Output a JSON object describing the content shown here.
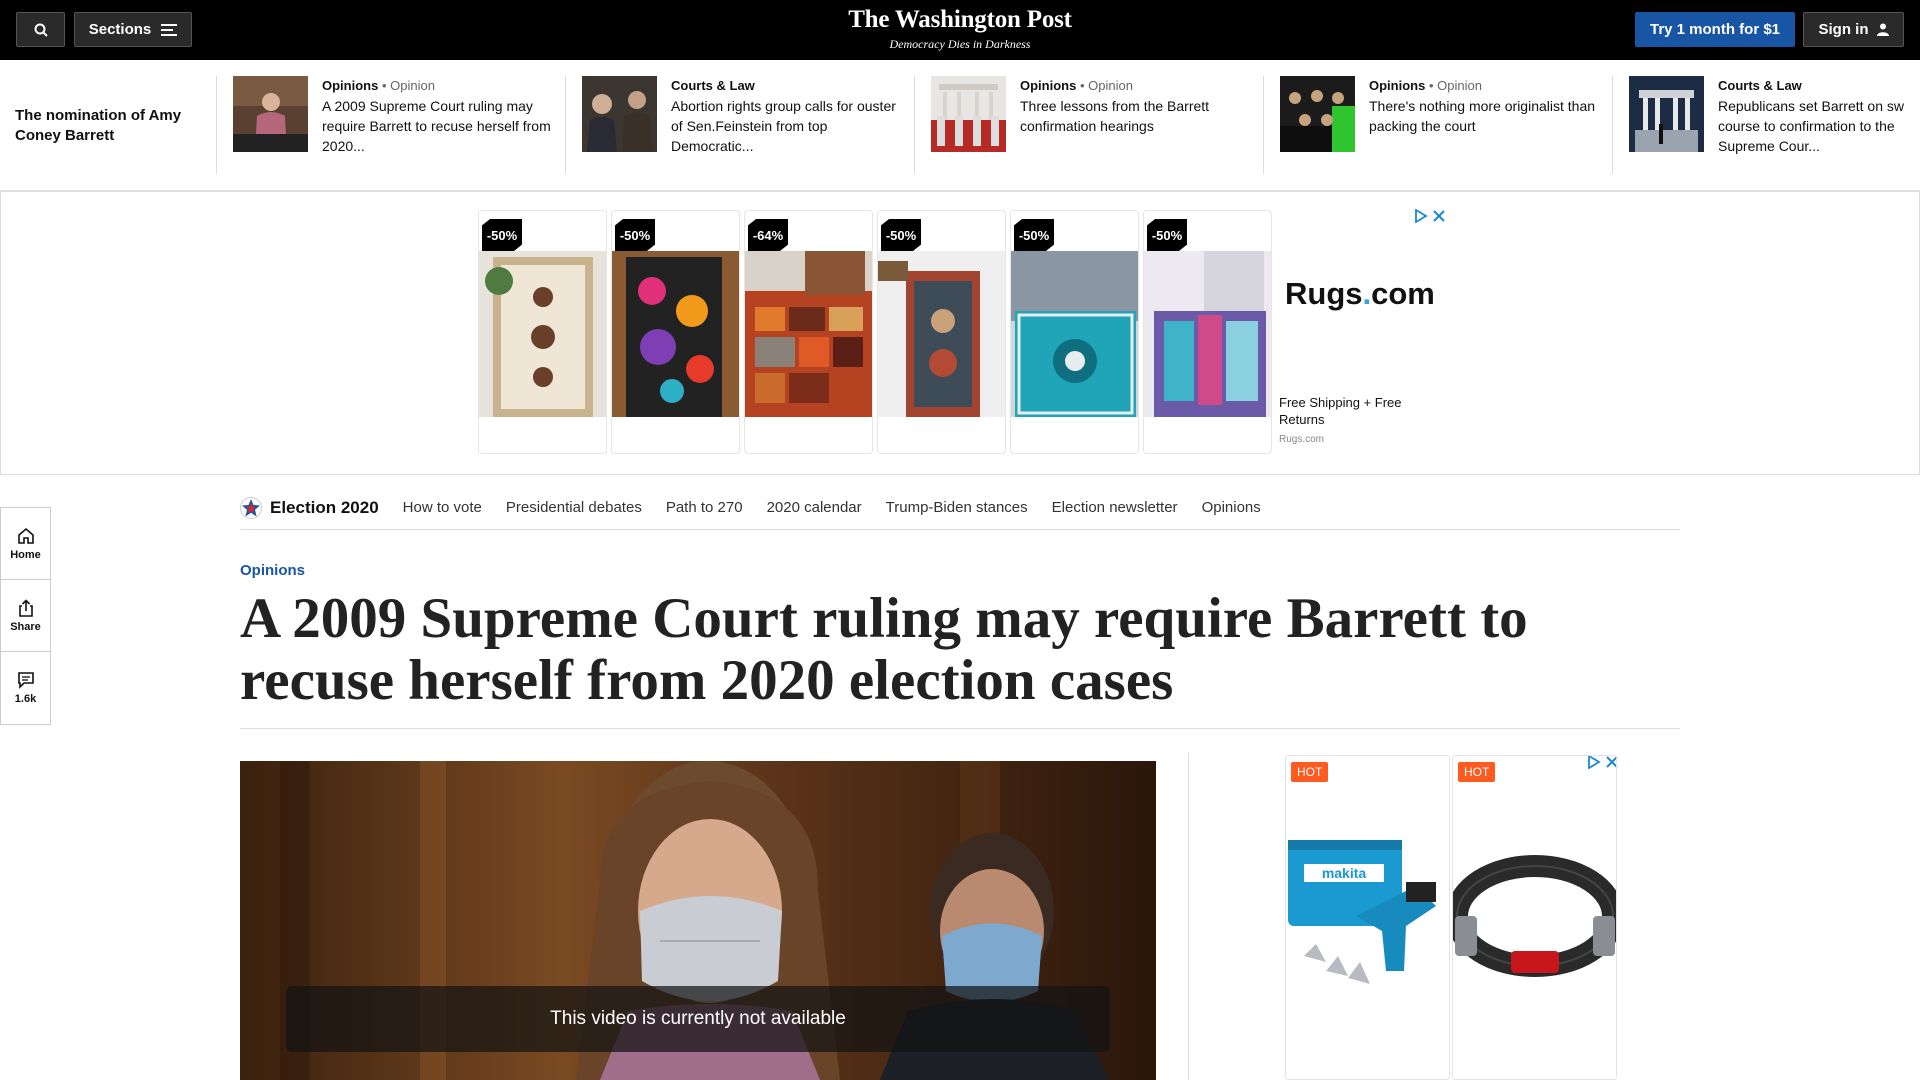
{
  "header": {
    "sections_label": "Sections",
    "logo": "The Washington Post",
    "tagline": "Democracy Dies in Darkness",
    "subscribe_label": "Try 1 month for $1",
    "signin_label": "Sign in"
  },
  "strip": {
    "title": "The nomination of Amy Coney Barrett",
    "items": [
      {
        "kicker": "Opinions",
        "sub": "• Opinion",
        "text": "A 2009 Supreme Court ruling may require Barrett to recuse herself from 2020..."
      },
      {
        "kicker": "Courts & Law",
        "sub": "",
        "text": "Abortion rights group calls for ouster of Sen.Feinstein from top Democratic..."
      },
      {
        "kicker": "Opinions",
        "sub": "• Opinion",
        "text": "Three lessons from the Barrett confirmation hearings"
      },
      {
        "kicker": "Opinions",
        "sub": "• Opinion",
        "text": "There's nothing more originalist than packing the court"
      },
      {
        "kicker": "Courts & Law",
        "sub": "",
        "text": "Republicans set Barrett on sw course to confirmation to the Supreme Cour..."
      }
    ]
  },
  "rug_ad": {
    "badges": [
      "-50%",
      "-50%",
      "-64%",
      "-50%",
      "-50%",
      "-50%"
    ],
    "brand_prefix": "Rugs",
    "brand_dot": ".",
    "brand_suffix": "com",
    "copy": "Free Shipping + Free Returns",
    "url": "Rugs.com"
  },
  "election_nav": {
    "brand": "Election 2020",
    "links": [
      "How to vote",
      "Presidential debates",
      "Path to 270",
      "2020 calendar",
      "Trump-Biden stances",
      "Election newsletter",
      "Opinions"
    ]
  },
  "rail": {
    "home": "Home",
    "share": "Share",
    "comments": "1.6k"
  },
  "article": {
    "kicker": "Opinions",
    "headline": "A 2009 Supreme Court ruling may require Barrett to recuse herself from 2020 election cases"
  },
  "video": {
    "message": "This video is currently not available"
  },
  "tool_ad": {
    "badges": [
      "HOT",
      "HOT"
    ]
  }
}
